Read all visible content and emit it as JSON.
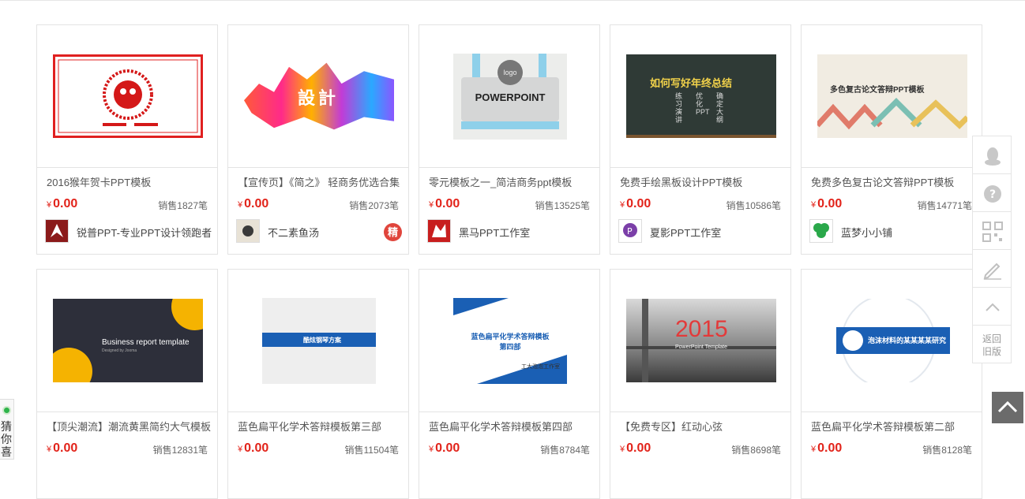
{
  "cards": [
    {
      "title": "2016猴年贺卡PPT模板",
      "currency": "¥",
      "price": "0.00",
      "sales": "销售1827笔",
      "shop": "锐普PPT-专业PPT设计领跑者",
      "badge": ""
    },
    {
      "title": "【宣传页】《简之》 轻商务优选合集",
      "currency": "¥",
      "price": "0.00",
      "sales": "销售2073笔",
      "shop": "不二素鱼汤",
      "badge": "精"
    },
    {
      "title": "零元模板之一_简洁商务ppt模板",
      "currency": "¥",
      "price": "0.00",
      "sales": "销售13525笔",
      "shop": "黑马PPT工作室",
      "badge": ""
    },
    {
      "title": "免费手绘黑板设计PPT模板",
      "currency": "¥",
      "price": "0.00",
      "sales": "销售10586笔",
      "shop": "夏影PPT工作室",
      "badge": ""
    },
    {
      "title": "免费多色复古论文答辩PPT模板",
      "currency": "¥",
      "price": "0.00",
      "sales": "销售14771笔",
      "shop": "蓝梦小小铺",
      "badge": ""
    },
    {
      "title": "【顶尖潮流】潮流黄黑简约大气模板",
      "currency": "¥",
      "price": "0.00",
      "sales": "销售12831笔"
    },
    {
      "title": "蓝色扁平化学术答辩模板第三部",
      "currency": "¥",
      "price": "0.00",
      "sales": "销售11504笔"
    },
    {
      "title": "蓝色扁平化学术答辩模板第四部",
      "currency": "¥",
      "price": "0.00",
      "sales": "销售8784笔"
    },
    {
      "title": "【免费专区】红动心弦",
      "currency": "¥",
      "price": "0.00",
      "sales": "销售8698笔"
    },
    {
      "title": "蓝色扁平化学术答辩模板第二部",
      "currency": "¥",
      "price": "0.00",
      "sales": "销售8128笔"
    }
  ],
  "thumb_text": {
    "design": "設計",
    "powerpoint": "POWERPOINT",
    "logo": "logo",
    "blackboard_title": "如何写好年终总结",
    "blackboard_cols": [
      "练习演讲",
      "优化PPT",
      "确定大纲"
    ],
    "retro_title": "多色复古论文答辩PPT模板",
    "business": "Business report template",
    "business_sub": "Designed by Jooma",
    "blue3": "酷炫钢琴方案",
    "blue4_title": "蓝色扁平化学术答辩模板",
    "blue4_sub": "第四部",
    "blue4_studio": "工大泡泡工作室",
    "year": "2015",
    "year_sub": "PowerPoint Template",
    "blue2": "泡沫材料的某某某某研究"
  },
  "sidebar": {
    "old_version": "返回旧版",
    "icons": [
      "qq-icon",
      "help-icon",
      "qrcode-icon",
      "edit-icon",
      "up-icon"
    ]
  },
  "guess": {
    "label": "猜你喜"
  },
  "colors": {
    "price": "#e2231a",
    "badge": "#e0453c",
    "accent_blue": "#1a5fb4"
  }
}
